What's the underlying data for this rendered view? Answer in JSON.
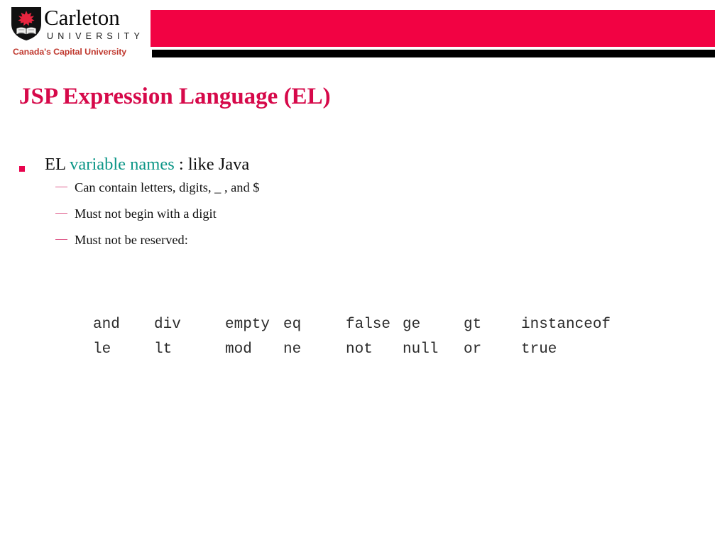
{
  "slide": {
    "background_color": "#ffffff",
    "title": "JSP Expression Language (EL)",
    "title_color": "#d6094a"
  },
  "branding": {
    "crest_icon": "carleton-shield-crest-icon",
    "wordmark": "Carleton",
    "wordmark_sub": "UNIVERSITY",
    "tagline": "Canada's Capital University",
    "tagline_color": "#c0392f",
    "bar_red_color": "#f20243",
    "bar_black_color": "#000000"
  },
  "content": {
    "bullets": [
      {
        "marker": "square-bullet-icon",
        "text_before": "EL ",
        "accent": "variable names",
        "accent_color": "#0c9687",
        "text_after": ": like Java",
        "sub_bullets": [
          {
            "marker": "dash-bullet-icon",
            "text": "Can contain letters, digits, _ , and $"
          },
          {
            "marker": "dash-bullet-icon",
            "text": "Must not begin with a digit"
          },
          {
            "marker": "dash-bullet-icon",
            "text": "Must not be reserved:"
          }
        ]
      }
    ]
  },
  "reserved_words": {
    "caption": "",
    "rows": [
      [
        "and",
        "div",
        "empty",
        "eq",
        "false",
        "ge",
        "gt",
        "instanceof"
      ],
      [
        "le",
        "lt",
        "mod",
        "ne",
        "not",
        "null",
        "or",
        "true"
      ]
    ]
  }
}
